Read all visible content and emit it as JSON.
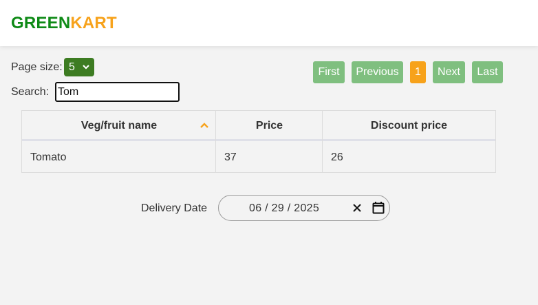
{
  "brand": {
    "part1": "GREEN",
    "part2": "KART"
  },
  "controls": {
    "page_size_label": "Page size:",
    "page_size_value": "5",
    "search_label": "Search:",
    "search_value": "Tom"
  },
  "pagination": {
    "first": "First",
    "previous": "Previous",
    "current": "1",
    "next": "Next",
    "last": "Last"
  },
  "table": {
    "headers": [
      "Veg/fruit name",
      "Price",
      "Discount price"
    ],
    "sort_icon": "sort-ascending-icon",
    "rows": [
      [
        "Tomato",
        "37",
        "26"
      ]
    ]
  },
  "delivery": {
    "label": "Delivery Date",
    "value": "06 / 29 / 2025",
    "clear_icon": "close-icon",
    "calendar_icon": "calendar-icon"
  },
  "colors": {
    "brand_green": "#0e8a16",
    "brand_orange": "#f7a21b",
    "pager_green": "#7fbf7f",
    "select_green": "#3d7c22"
  }
}
